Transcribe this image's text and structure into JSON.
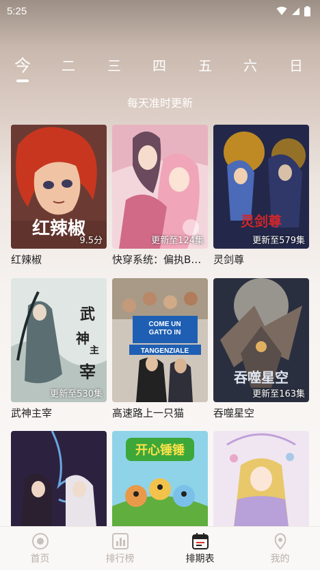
{
  "status_bar": {
    "time": "5:25"
  },
  "day_tabs": [
    {
      "label": "今",
      "active": true
    },
    {
      "label": "二",
      "active": false
    },
    {
      "label": "三",
      "active": false
    },
    {
      "label": "四",
      "active": false
    },
    {
      "label": "五",
      "active": false
    },
    {
      "label": "六",
      "active": false
    },
    {
      "label": "日",
      "active": false
    }
  ],
  "subtitle": "每天准时更新",
  "cards": [
    {
      "title": "红辣椒",
      "badge": "9.5分",
      "cover_text": "红辣椒",
      "theme": "red-hair"
    },
    {
      "title": "快穿系统：偏执B…",
      "badge": "更新至124集",
      "cover_text": "",
      "theme": "pink-romance"
    },
    {
      "title": "灵剑尊",
      "badge": "更新至579集",
      "cover_text": "灵剑尊",
      "theme": "blue-armor"
    },
    {
      "title": "武神主宰",
      "badge": "更新至530集",
      "cover_text": "武神主宰",
      "theme": "ink-warrior"
    },
    {
      "title": "高速路上一只猫",
      "badge": "",
      "cover_text": "COME UN GATTO IN TANGENZIALE",
      "theme": "italian-movie"
    },
    {
      "title": "吞噬星空",
      "badge": "更新至163集",
      "cover_text": "吞噬星空",
      "theme": "mech-space"
    },
    {
      "title": "",
      "badge": "",
      "cover_text": "",
      "theme": "dark-fantasy"
    },
    {
      "title": "",
      "badge": "",
      "cover_text": "开心锤锤",
      "theme": "cartoon-kids"
    },
    {
      "title": "",
      "badge": "",
      "cover_text": "",
      "theme": "lolita-girl"
    }
  ],
  "bottom_nav": [
    {
      "label": "首页",
      "icon": "home-icon",
      "active": false
    },
    {
      "label": "排行榜",
      "icon": "chart-icon",
      "active": false
    },
    {
      "label": "排期表",
      "icon": "calendar-icon",
      "active": true
    },
    {
      "label": "我的",
      "icon": "profile-icon",
      "active": false
    }
  ]
}
